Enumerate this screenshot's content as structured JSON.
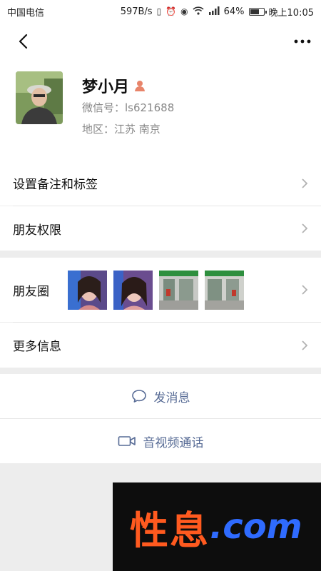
{
  "status_bar": {
    "carrier": "中国电信",
    "net_speed": "597B/s",
    "battery_percent": "64%",
    "battery_level": 0.64,
    "time": "晚上10:05"
  },
  "profile": {
    "name": "梦小月",
    "wechat_id": "微信号：ls621688",
    "region": "地区：江苏  南京"
  },
  "menu": {
    "remark_label": "设置备注和标签",
    "permissions_label": "朋友权限",
    "moments_label": "朋友圈",
    "more_info_label": "更多信息"
  },
  "actions": {
    "message_label": "发消息",
    "call_label": "音视频通话"
  },
  "ad": {
    "text_cn": "性息",
    "text_domain": ".com"
  },
  "colors": {
    "link_blue": "#576b95",
    "background_gray": "#ededed"
  }
}
